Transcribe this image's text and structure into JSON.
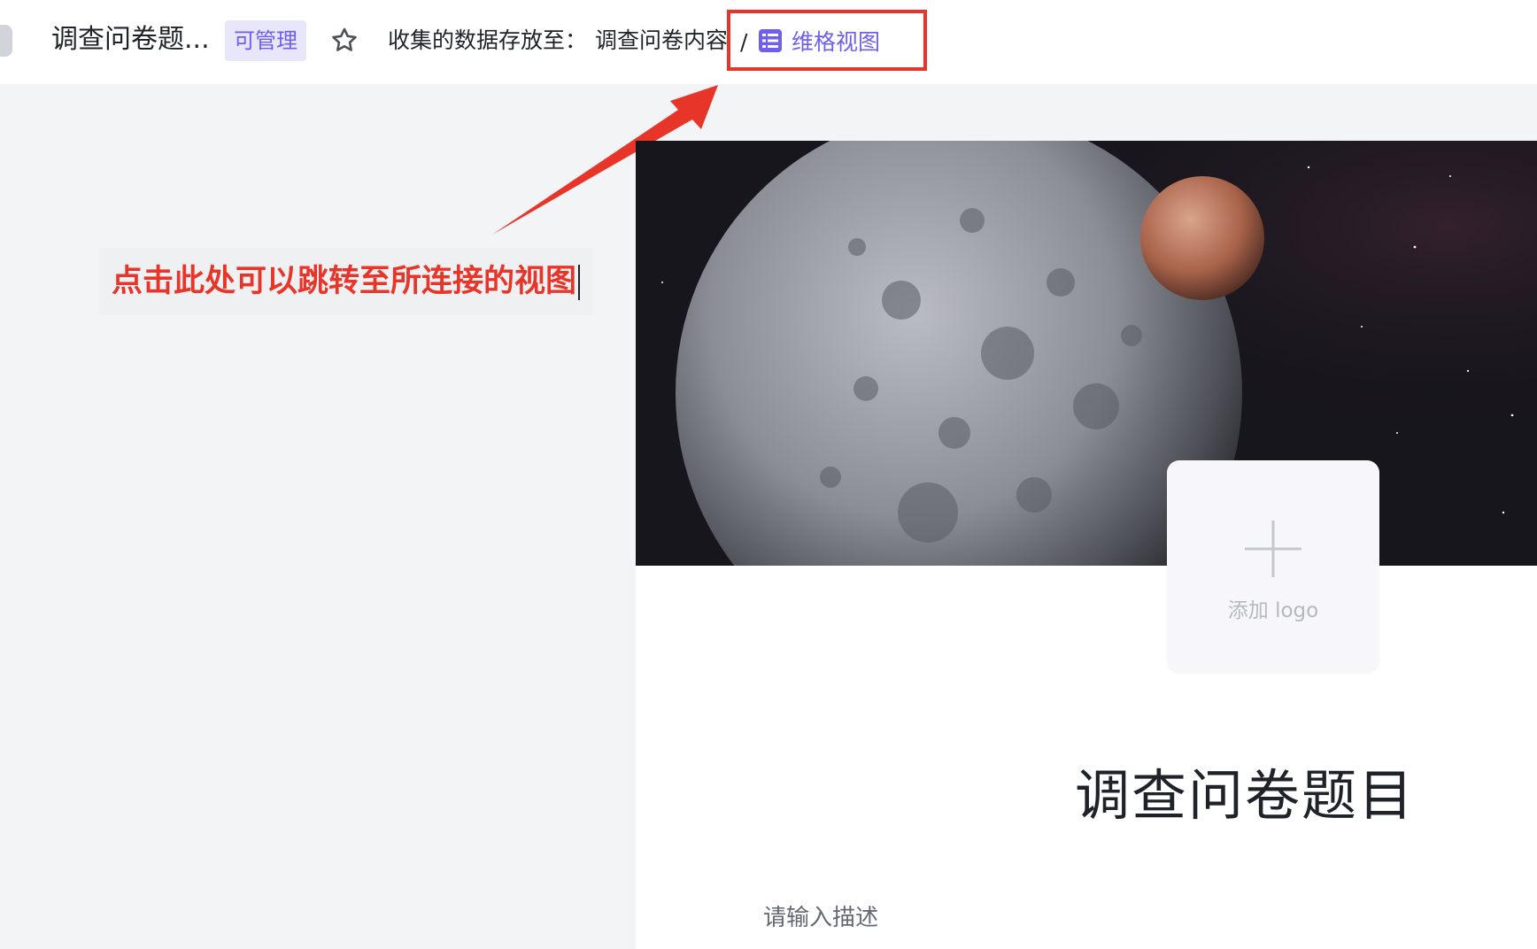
{
  "header": {
    "doc_title": "调查问卷题...",
    "permission_badge": "可管理",
    "storage_label": "收集的数据存放至：",
    "storage_target": "调查问卷内容",
    "path_separator": "/",
    "view_link": "维格视图"
  },
  "annotation": {
    "text": "点击此处可以跳转至所连接的视图"
  },
  "form": {
    "add_logo_label": "添加 logo",
    "title": "调查问卷题目",
    "description_placeholder": "请输入描述"
  },
  "colors": {
    "accent": "#6e5ff0",
    "annotation_red": "#e8352a",
    "badge_bg": "#e8e6fb",
    "page_bg": "#f3f4f6"
  },
  "icons": {
    "star": "star-outline-icon",
    "view": "grid-view-icon",
    "add": "plus-icon"
  }
}
